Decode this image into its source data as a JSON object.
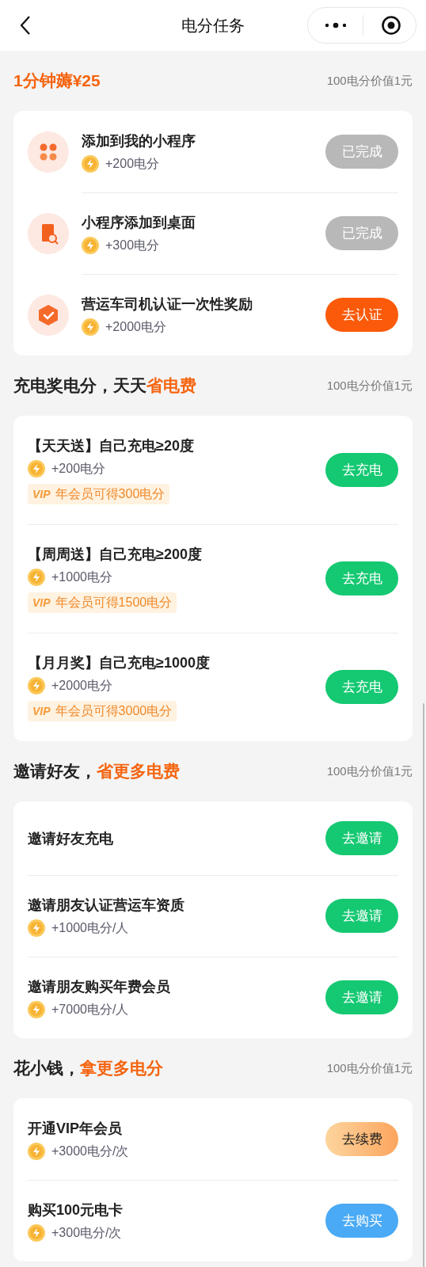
{
  "nav": {
    "title": "电分任务"
  },
  "sections": [
    {
      "kind": "with-icons",
      "heading": [
        {
          "text": "1分钟薅¥25",
          "accent": true
        }
      ],
      "note": "100电分价值1元",
      "rows": [
        {
          "title": "添加到我的小程序",
          "points": "+200电分",
          "button": {
            "label": "已完成",
            "kind": "done"
          }
        },
        {
          "title": "小程序添加到桌面",
          "points": "+300电分",
          "button": {
            "label": "已完成",
            "kind": "done"
          }
        },
        {
          "title": "营运车司机认证一次性奖励",
          "points": "+2000电分",
          "button": {
            "label": "去认证",
            "kind": "orange"
          }
        }
      ]
    },
    {
      "heading": [
        {
          "text": "充电奖电分，天天",
          "accent": false
        },
        {
          "text": "省电费",
          "accent": true
        }
      ],
      "note": "100电分价值1元",
      "rows": [
        {
          "title": "【天天送】自己充电≥20度",
          "points": "+200电分",
          "vip": {
            "badge": "VIP",
            "text": "年会员可得300电分"
          },
          "button": {
            "label": "去充电",
            "kind": "green"
          }
        },
        {
          "title": "【周周送】自己充电≥200度",
          "points": "+1000电分",
          "vip": {
            "badge": "VIP",
            "text": "年会员可得1500电分"
          },
          "button": {
            "label": "去充电",
            "kind": "green"
          }
        },
        {
          "title": "【月月奖】自己充电≥1000度",
          "points": "+2000电分",
          "vip": {
            "badge": "VIP",
            "text": "年会员可得3000电分"
          },
          "button": {
            "label": "去充电",
            "kind": "green"
          }
        }
      ]
    },
    {
      "heading": [
        {
          "text": "邀请好友，",
          "accent": false
        },
        {
          "text": "省更多电费",
          "accent": true
        }
      ],
      "note": "100电分价值1元",
      "rows": [
        {
          "title": "邀请好友充电",
          "button": {
            "label": "去邀请",
            "kind": "green"
          }
        },
        {
          "title": "邀请朋友认证营运车资质",
          "points": "+1000电分/人",
          "button": {
            "label": "去邀请",
            "kind": "green"
          }
        },
        {
          "title": "邀请朋友购买年费会员",
          "points": "+7000电分/人",
          "button": {
            "label": "去邀请",
            "kind": "green"
          }
        }
      ]
    },
    {
      "heading": [
        {
          "text": "花小钱，",
          "accent": false
        },
        {
          "text": "拿更多电分",
          "accent": true
        }
      ],
      "note": "100电分价值1元",
      "rows": [
        {
          "title": "开通VIP年会员",
          "points": "+3000电分/次",
          "button": {
            "label": "去续费",
            "kind": "peach"
          }
        },
        {
          "title": "购买100元电卡",
          "points": "+300电分/次",
          "button": {
            "label": "去购买",
            "kind": "blue"
          }
        }
      ]
    }
  ]
}
